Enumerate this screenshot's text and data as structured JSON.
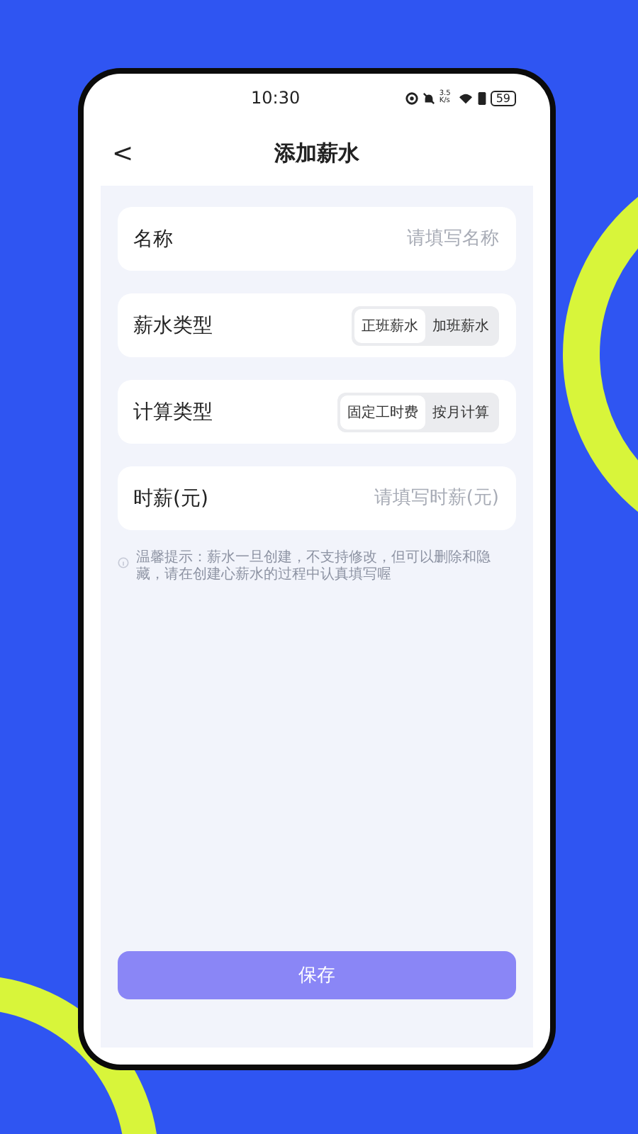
{
  "status_bar": {
    "time": "10:30",
    "network_speed": "3.5 K/s",
    "battery": "59"
  },
  "header": {
    "back": "<",
    "title": "添加薪水"
  },
  "form": [
    {
      "kind": "input",
      "label": "名称",
      "placeholder": "请填写名称"
    },
    {
      "kind": "segmented",
      "label": "薪水类型",
      "options": [
        {
          "label": "正班薪水",
          "selected": true
        },
        {
          "label": "加班薪水",
          "selected": false
        }
      ]
    },
    {
      "kind": "segmented",
      "label": "计算类型",
      "options": [
        {
          "label": "固定工时费",
          "selected": true
        },
        {
          "label": "按月计算",
          "selected": false
        }
      ]
    },
    {
      "kind": "input",
      "label": "时薪(元)",
      "placeholder": "请填写时薪(元)"
    }
  ],
  "tip": "温馨提示：薪水一旦创建，不支持修改，但可以删除和隐藏，请在创建心薪水的过程中认真填写喔",
  "save_button": "保存"
}
